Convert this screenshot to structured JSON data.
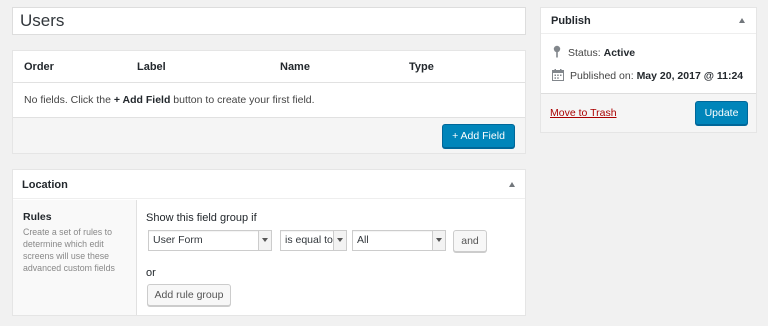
{
  "title_input": {
    "value": "Users"
  },
  "fields": {
    "columns": [
      "Order",
      "Label",
      "Name",
      "Type"
    ],
    "empty_prefix": "No fields. Click the ",
    "empty_link": "+ Add Field",
    "empty_suffix": " button to create your first field.",
    "add_button": "+ Add Field"
  },
  "location": {
    "title": "Location",
    "rules_label": "Rules",
    "rules_description": "Create a set of rules to determine which edit screens will use these advanced custom fields",
    "show_if": "Show this field group if",
    "param_select": "User Form",
    "operator_select": "is equal to",
    "value_select": "All",
    "and_button": "and",
    "or_label": "or",
    "add_group_button": "Add rule group"
  },
  "publish": {
    "title": "Publish",
    "status_label": "Status:",
    "status_value": "Active",
    "published_label": "Published on:",
    "published_value": "May 20, 2017 @ 11:24",
    "trash_link": "Move to Trash",
    "update_button": "Update"
  },
  "colors": {
    "primary": "#0085ba",
    "trash": "#aa0000",
    "background": "#f1f1f1"
  },
  "icons": [
    "pin-icon",
    "calendar-icon",
    "toggle-arrow-icon",
    "chevron-down-icon"
  ]
}
